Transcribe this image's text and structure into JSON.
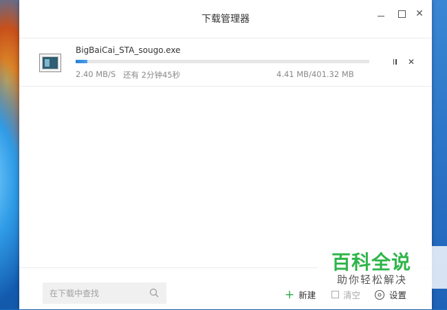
{
  "window": {
    "title": "下载管理器"
  },
  "download": {
    "file_name": "BigBaiCai_STA_sougo.exe",
    "progress_fraction": 0.04,
    "speed": "2.40 MB/S",
    "remaining": "还有 2分钟45秒",
    "size": "4.41 MB/401.32 MB"
  },
  "footer": {
    "search_placeholder": "在下载中查找",
    "new_label": "新建",
    "clear_label": "清空",
    "settings_label": "设置"
  },
  "watermark": {
    "title": "百科全说",
    "subtitle": "助你轻松解决"
  },
  "colors": {
    "accent": "#2b7fd4",
    "new_icon": "#2aa84a",
    "watermark_green": "#2fb54a"
  },
  "icons": {
    "file": "exe-file-icon",
    "pause": "pause-icon",
    "cancel": "close-icon",
    "search": "search-icon",
    "new": "plus-icon",
    "clear": "checkbox-icon",
    "settings": "gear-icon"
  }
}
